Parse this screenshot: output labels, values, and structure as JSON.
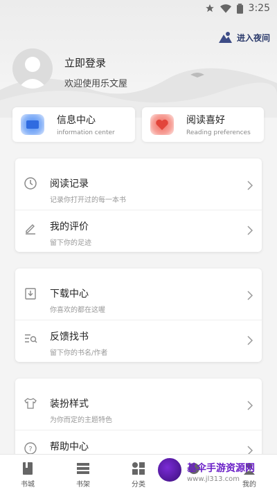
{
  "status": {
    "time": "3:25"
  },
  "header": {
    "night_mode_label": "进入夜间",
    "login_title": "立即登录",
    "login_subtitle": "欢迎使用乐文屋"
  },
  "quick_cards": [
    {
      "title": "信息中心",
      "subtitle": "information center",
      "color": "#3a7bf0"
    },
    {
      "title": "阅读喜好",
      "subtitle": "Reading preferences",
      "color": "#f2584e"
    }
  ],
  "groups": [
    [
      {
        "title": "阅读记录",
        "subtitle": "记录你打开过的每一本书",
        "icon": "clock-icon"
      },
      {
        "title": "我的评价",
        "subtitle": "留下你的足迹",
        "icon": "pen-icon"
      }
    ],
    [
      {
        "title": "下载中心",
        "subtitle": "你喜欢的都在这喔",
        "icon": "download-icon"
      },
      {
        "title": "反馈找书",
        "subtitle": "留下你的书名/作者",
        "icon": "search-list-icon"
      }
    ],
    [
      {
        "title": "装扮样式",
        "subtitle": "为你而定的主题特色",
        "icon": "shirt-icon"
      },
      {
        "title": "帮助中心",
        "subtitle": "",
        "icon": "help-icon"
      }
    ]
  ],
  "bottom_nav": [
    {
      "label": "书城",
      "icon": "book-icon"
    },
    {
      "label": "书架",
      "icon": "shelf-icon"
    },
    {
      "label": "分类",
      "icon": "category-icon"
    },
    {
      "label": "",
      "icon": "discover-icon"
    },
    {
      "label": "我的",
      "icon": "user-icon"
    }
  ],
  "watermark": {
    "text": "基伞手游资源网",
    "url": "www.jl313.com"
  }
}
